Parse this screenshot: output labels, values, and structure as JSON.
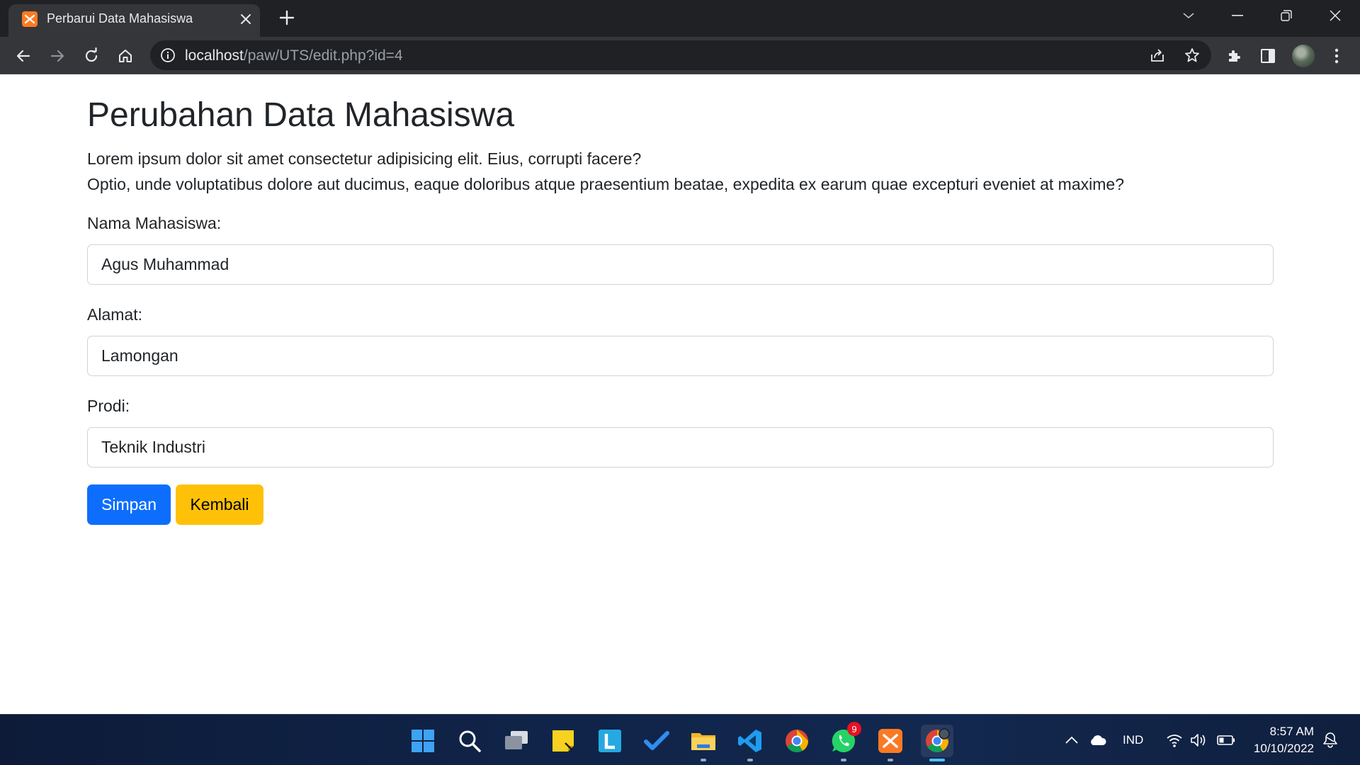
{
  "browser": {
    "tab_title": "Perbarui Data Mahasiswa",
    "url_host": "localhost",
    "url_path": "/paw/UTS/edit.php?id=4"
  },
  "page": {
    "title": "Perubahan Data Mahasiswa",
    "lead_line1": "Lorem ipsum dolor sit amet consectetur adipisicing elit. Eius, corrupti facere?",
    "lead_line2": "Optio, unde voluptatibus dolore aut ducimus, eaque doloribus atque praesentium beatae, expedita ex earum quae excepturi eveniet at maxime?",
    "fields": [
      {
        "label": "Nama Mahasiswa:",
        "value": "Agus Muhammad"
      },
      {
        "label": "Alamat:",
        "value": "Lamongan"
      },
      {
        "label": "Prodi:",
        "value": "Teknik Industri"
      }
    ],
    "buttons": {
      "save": "Simpan",
      "back": "Kembali"
    }
  },
  "taskbar": {
    "apps": [
      "start-icon",
      "search-icon",
      "task-view-icon",
      "sticky-notes-icon",
      "launcher-l-icon",
      "todo-icon",
      "file-explorer-icon",
      "vscode-icon",
      "chrome-icon",
      "whatsapp-icon",
      "xampp-icon",
      "chrome-profile-icon"
    ],
    "whatsapp_badge": "9",
    "language": "IND",
    "time": "8:57 AM",
    "date": "10/10/2022"
  },
  "colors": {
    "primary": "#0d6efd",
    "warning": "#ffc107",
    "chrome_dark": "#202124",
    "chrome_toolbar": "#35363a"
  }
}
